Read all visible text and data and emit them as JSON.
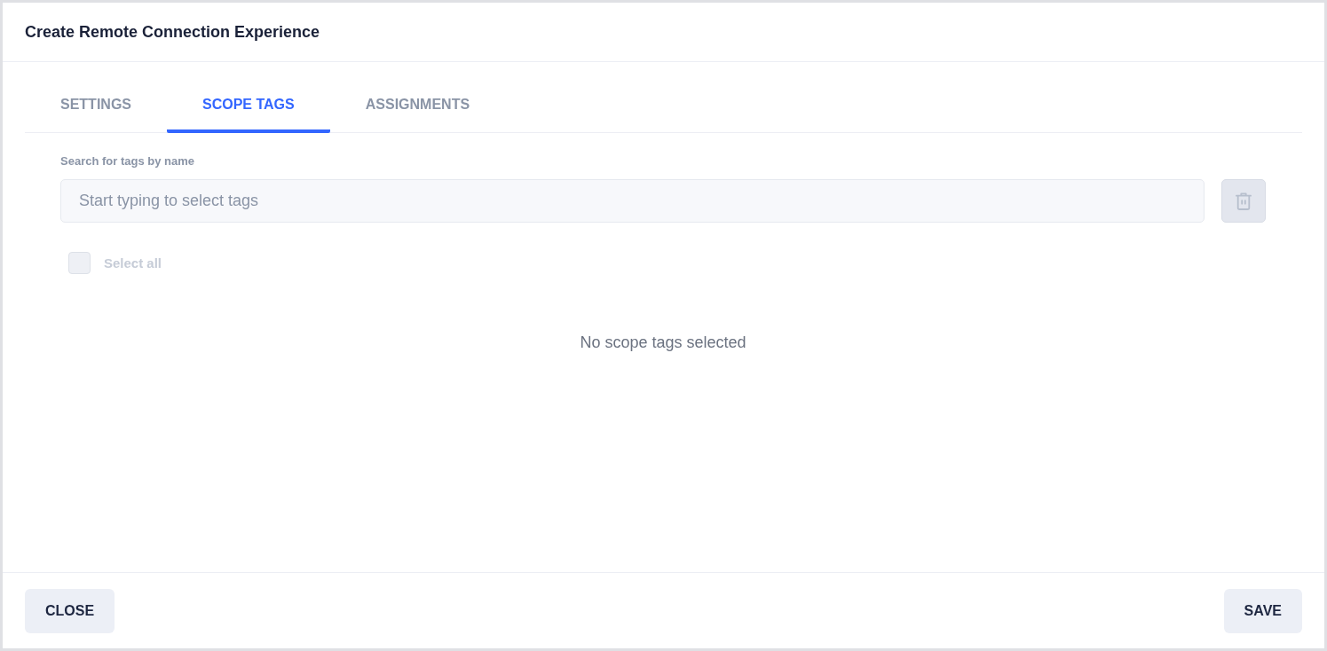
{
  "dialog": {
    "title": "Create Remote Connection Experience"
  },
  "tabs": [
    {
      "label": "SETTINGS",
      "selected": false
    },
    {
      "label": "SCOPE TAGS",
      "selected": true
    },
    {
      "label": "ASSIGNMENTS",
      "selected": false
    }
  ],
  "search": {
    "label": "Search for tags by name",
    "placeholder": "Start typing to select tags"
  },
  "delete_button": {
    "disabled": true
  },
  "select_all": {
    "label": "Select all",
    "checked": false,
    "disabled": true
  },
  "empty_message": "No scope tags selected",
  "buttons": [
    {
      "label": "CLOSE"
    },
    {
      "label": "SAVE"
    }
  ]
}
